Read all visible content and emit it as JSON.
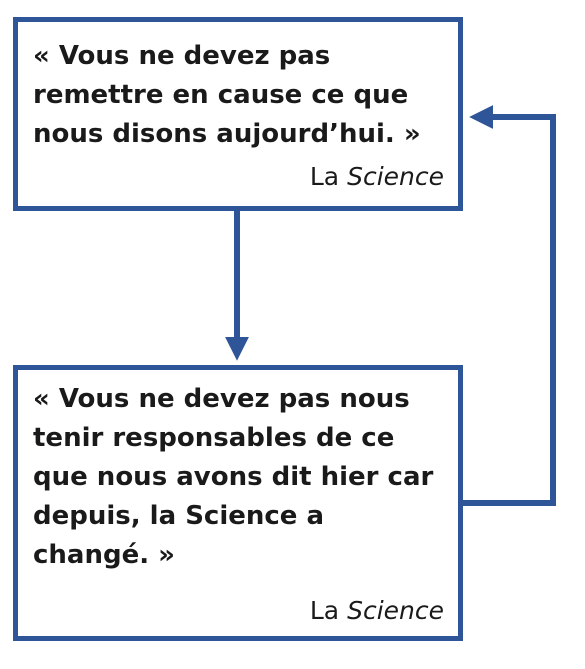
{
  "colors": {
    "border": "#2e5597",
    "arrow": "#2e5597",
    "text": "#1a1a1a",
    "background": "#ffffff"
  },
  "top_box": {
    "quote": "« Vous ne devez pas\nremettre en cause ce que\nnous disons aujourd’hui. »",
    "attribution_prefix": "La ",
    "attribution_emphasis": "Science"
  },
  "bottom_box": {
    "quote": "« Vous ne devez pas nous\ntenir responsables de ce\nque nous avons dit hier car\ndepuis, la Science a\nchangé. »",
    "attribution_prefix": "La ",
    "attribution_emphasis": "Science"
  }
}
